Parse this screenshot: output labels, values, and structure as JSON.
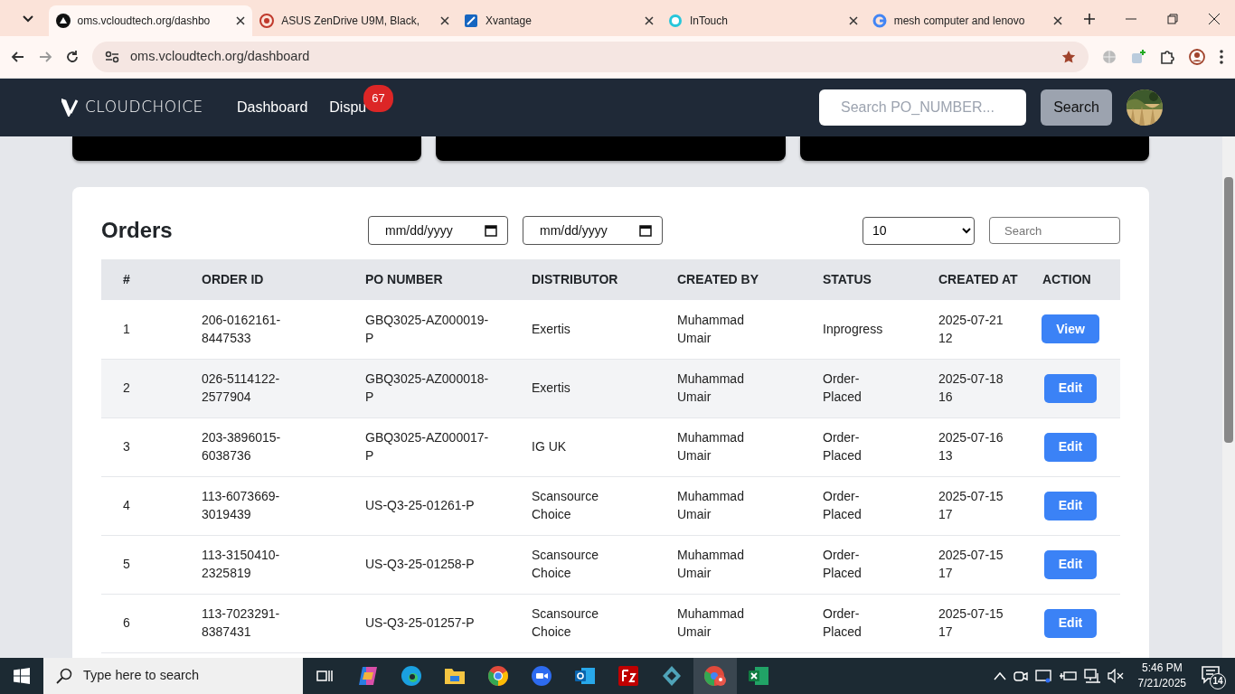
{
  "browser": {
    "tabs": [
      {
        "title": "oms.vcloudtech.org/dashbo",
        "selected": true
      },
      {
        "title": "ASUS ZenDrive U9M, Black, ",
        "selected": false
      },
      {
        "title": "Xvantage",
        "selected": false
      },
      {
        "title": "InTouch",
        "selected": false
      },
      {
        "title": "mesh computer and lenovo",
        "selected": false
      }
    ],
    "url": "oms.vcloudtech.org/dashboard"
  },
  "navbar": {
    "logo": "CLOUDCHOICE",
    "links": [
      {
        "label": "Dashboard"
      },
      {
        "label": "Dispu",
        "badge": "67"
      }
    ],
    "search_placeholder": "Search PO_NUMBER...",
    "search_button": "Search"
  },
  "orders": {
    "title": "Orders",
    "date_from": {
      "placeholder": "mm/dd/yyyy"
    },
    "date_to": {
      "placeholder": "mm/dd/yyyy"
    },
    "page_size": "10",
    "search_placeholder": "Search",
    "columns": [
      "#",
      "ORDER ID",
      "PO NUMBER",
      "DISTRIBUTOR",
      "CREATED BY",
      "STATUS",
      "CREATED AT",
      "ACTION"
    ],
    "rows": [
      {
        "n": "1",
        "order_id": "206-0162161-8447533",
        "po_number": "GBQ3025-AZ000019-P",
        "distributor": "Exertis",
        "created_by": "Muhammad Umair",
        "status": "Inprogress",
        "created_at": "2025-07-21 12",
        "action": "View",
        "hovered": false
      },
      {
        "n": "2",
        "order_id": "026-5114122-2577904",
        "po_number": "GBQ3025-AZ000018-P",
        "distributor": "Exertis",
        "created_by": "Muhammad Umair",
        "status": "Order-Placed",
        "created_at": "2025-07-18 16",
        "action": "Edit",
        "hovered": true
      },
      {
        "n": "3",
        "order_id": "203-3896015-6038736",
        "po_number": "GBQ3025-AZ000017-P",
        "distributor": "IG UK",
        "created_by": "Muhammad Umair",
        "status": "Order-Placed",
        "created_at": "2025-07-16 13",
        "action": "Edit",
        "hovered": false
      },
      {
        "n": "4",
        "order_id": "113-6073669-3019439",
        "po_number": "US-Q3-25-01261-P",
        "distributor": "Scansource Choice",
        "created_by": "Muhammad Umair",
        "status": "Order-Placed",
        "created_at": "2025-07-15 17",
        "action": "Edit",
        "hovered": false
      },
      {
        "n": "5",
        "order_id": "113-3150410-2325819",
        "po_number": "US-Q3-25-01258-P",
        "distributor": "Scansource Choice",
        "created_by": "Muhammad Umair",
        "status": "Order-Placed",
        "created_at": "2025-07-15 17",
        "action": "Edit",
        "hovered": false
      },
      {
        "n": "6",
        "order_id": "113-7023291-8387431",
        "po_number": "US-Q3-25-01257-P",
        "distributor": "Scansource Choice",
        "created_by": "Muhammad Umair",
        "status": "Order-Placed",
        "created_at": "2025-07-15 17",
        "action": "Edit",
        "hovered": false
      }
    ]
  },
  "taskbar": {
    "search_placeholder": "Type here to search",
    "time": "5:46 PM",
    "date": "7/21/2025",
    "notifications": "14"
  }
}
